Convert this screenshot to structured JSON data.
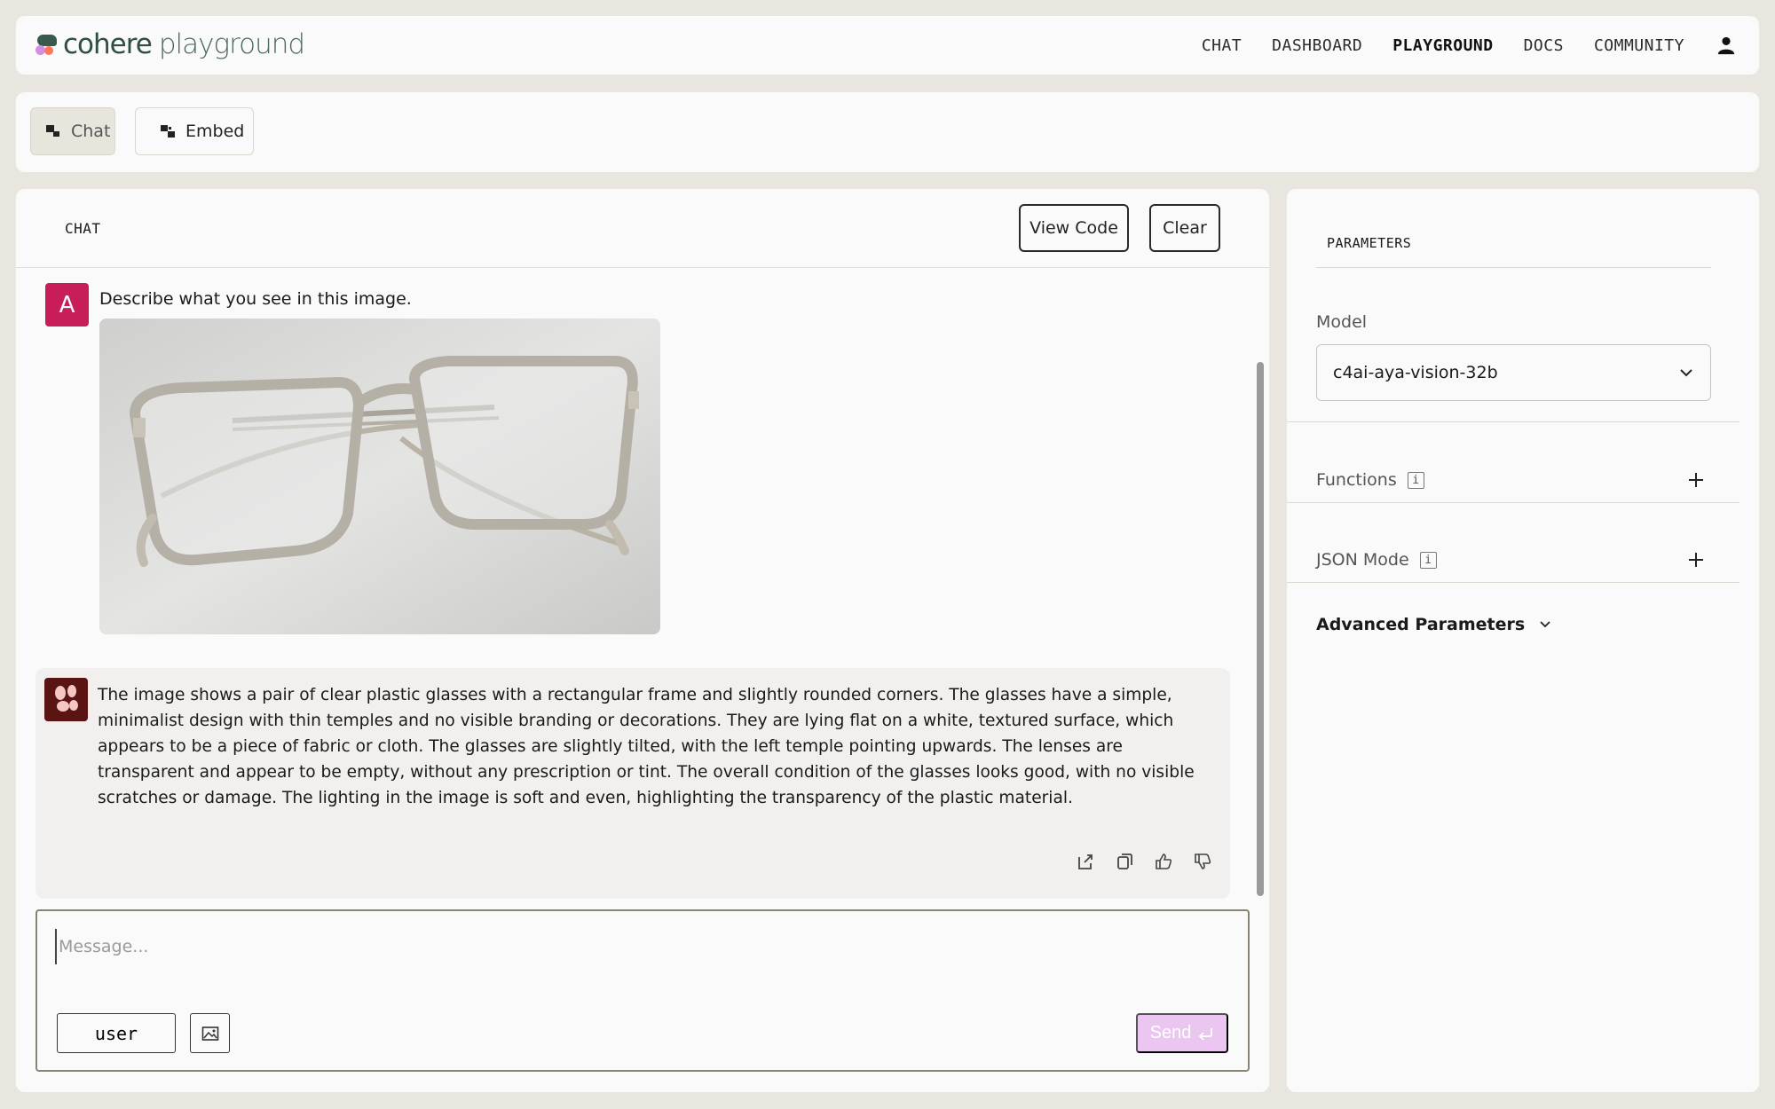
{
  "brand": {
    "name_main": "cohere",
    "name_sub": "playground"
  },
  "nav": {
    "items": [
      {
        "label": "CHAT",
        "active": false
      },
      {
        "label": "DASHBOARD",
        "active": false
      },
      {
        "label": "PLAYGROUND",
        "active": true
      },
      {
        "label": "DOCS",
        "active": false
      },
      {
        "label": "COMMUNITY",
        "active": false
      }
    ],
    "user_icon": "user-icon"
  },
  "tabs": [
    {
      "label": "Chat",
      "icon": "chat-icon",
      "active": true
    },
    {
      "label": "Embed",
      "icon": "embed-icon",
      "active": false
    }
  ],
  "chat": {
    "title": "CHAT",
    "view_code_label": "View Code",
    "clear_label": "Clear",
    "user_avatar_letter": "A",
    "user_message": "Describe what you see in this image.",
    "bot_response": "The image shows a pair of clear plastic glasses with a rectangular frame and slightly rounded corners. The glasses have a simple, minimalist design with thin temples and no visible branding or decorations. They are lying flat on a white, textured surface, which appears to be a piece of fabric or cloth. The glasses are slightly tilted, with the left temple pointing upwards. The lenses are transparent and appear to be empty, without any prescription or tint. The overall condition of the glasses looks good, with no visible scratches or damage. The lighting in the image is soft and even, highlighting the transparency of the plastic material.",
    "action_icons": [
      "share-icon",
      "copy-icon",
      "thumbs-up-icon",
      "thumbs-down-icon"
    ]
  },
  "composer": {
    "placeholder": "Message...",
    "value": "",
    "role_label": "user",
    "send_label": "Send",
    "send_color": "#ebc6f0"
  },
  "parameters": {
    "title": "PARAMETERS",
    "model_label": "Model",
    "model_value": "c4ai-aya-vision-32b",
    "functions_label": "Functions",
    "json_mode_label": "JSON Mode",
    "info_glyph": "i",
    "advanced_label": "Advanced Parameters"
  },
  "colors": {
    "background": "#e9e6df",
    "user_avatar": "#c71d5a",
    "bot_avatar": "#5a1412",
    "brand_green": "#39594d"
  }
}
